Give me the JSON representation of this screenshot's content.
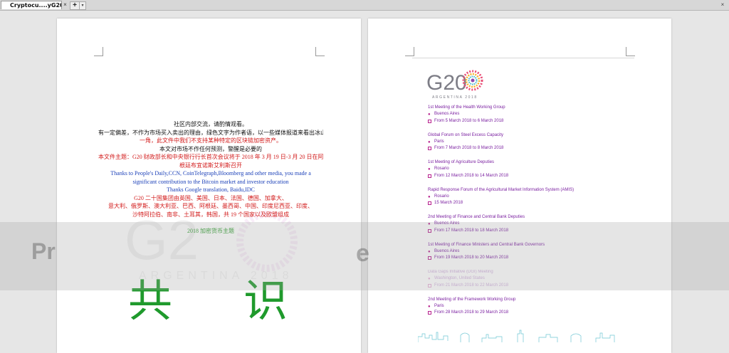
{
  "tab": {
    "title": "Cryptocu....yG20.doc",
    "close": "×",
    "add": "+",
    "menu": "▾"
  },
  "window": {
    "close": "×"
  },
  "page1": {
    "lines": [
      "社区内部交流，请酌情观看。",
      "有一定偏差，不作为市场买入卖出的理由，绿色文字为作者语，以一些媒体报道来看出冰山",
      "一角，此文件中我们不支持某种特定的区块链加密资产。",
      "本文对市场不作任何预测，警醒是必要的",
      "本文件主题：G20 财政部长和中央银行行长首次会议将于 2018 年 3 月 19 日-3 月 20 日在阿",
      "根廷布宜诺斯艾利斯召开",
      "Thanks to People's Daily,CCN, CoinTelegraph,Bloomberg and other media, you made a",
      "significant contribution to the Bitcoin market and investor education",
      "Thanks Google translation, Baidu,IDC",
      "G20 二十国集团由英国、美国、日本、法国、德国、加拿大、",
      "意大利、俄罗斯、澳大利亚、巴西、阿根廷、墨西哥、中国、印度尼西亚、印度、",
      "沙特阿拉伯、南非、土耳其，韩国，共 19 个国家以及欧盟组成",
      "2018 加密货币主题"
    ],
    "big_left": "共",
    "big_right": "识",
    "watermark": "Pr"
  },
  "page2": {
    "logo_text": "G20",
    "logo_sub": "ARGENTINA 2018",
    "events": [
      {
        "title": "1st Meeting of the Health Working Group",
        "location": "Buenos Aires",
        "date": "From 5 March 2018 to 6 March 2018"
      },
      {
        "title": "Global Forum on Steel Excess Capacity",
        "location": "Paris",
        "date": "From 7 March 2018 to 8 March 2018"
      },
      {
        "title": "1st Meeting of Agriculture Deputies",
        "location": "Rosario",
        "date": "From 12 March 2018 to 14 March 2018"
      },
      {
        "title": "Rapid Response Forum of the Agricultural Market Information System (AMIS)",
        "location": "Rosario",
        "date": "15 March 2018"
      },
      {
        "title": "2nd Meeting of Finance and Central Bank Deputies",
        "location": "Buenos Aires",
        "date": "From 17 March 2018 to 18 March 2018"
      },
      {
        "title": "1st Meeting of Finance Ministers and Central Bank Governors",
        "location": "Buenos Aires",
        "date": "From 19 March 2018 to 20 March 2018"
      },
      {
        "title": "Data Gaps Initiative (DGI) Meeting",
        "location": "Washington, United States",
        "date": "From 21 March 2018 to 22 March 2018"
      },
      {
        "title": "2nd Meeting of the Framework Working Group",
        "location": "Paris",
        "date": "From 28 March 2018 to 29 March 2018"
      }
    ]
  },
  "colors": {
    "accent": "#7a1fa0",
    "pin": "#b8238f",
    "green": "#1f9a2c",
    "red": "#d21a1a",
    "blue": "#1a3fb8"
  }
}
